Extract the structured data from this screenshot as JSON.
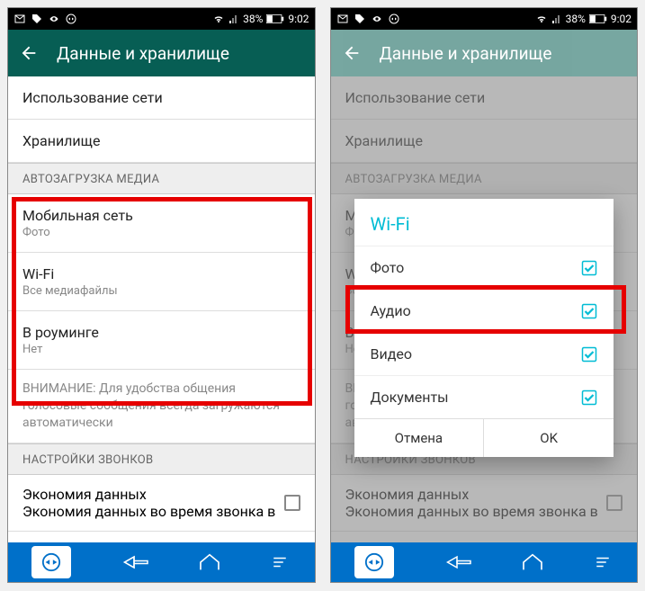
{
  "status": {
    "battery": "38%",
    "time": "9:02"
  },
  "appbar": {
    "title": "Данные и хранилище"
  },
  "rows": {
    "network_usage": "Использование сети",
    "storage": "Хранилище"
  },
  "section_autodl": "АВТОЗАГРУЗКА МЕДИА",
  "autodl": {
    "mobile": {
      "title": "Мобильная сеть",
      "sub": "Фото"
    },
    "wifi": {
      "title": "Wi-Fi",
      "sub": "Все медиафайлы"
    },
    "roaming": {
      "title": "В роуминге",
      "sub": "Нет"
    }
  },
  "note": "ВНИМАНИЕ: Для удобства общения голосовые сообщения всегда загружаются автоматически",
  "section_calls": "НАСТРОЙКИ ЗВОНКОВ",
  "econ": {
    "title": "Экономия данных",
    "sub": "Экономия данных во время звонка в"
  },
  "dialog": {
    "title": "Wi-Fi",
    "items": {
      "photo": "Фото",
      "audio": "Аудио",
      "video": "Видео",
      "docs": "Документы"
    },
    "cancel": "Отмена",
    "ok": "OK"
  }
}
